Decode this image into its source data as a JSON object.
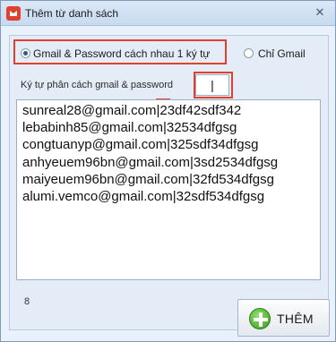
{
  "window": {
    "title": "Thêm từ danh sách",
    "close_glyph": "✕"
  },
  "options": {
    "gmail_password": {
      "label": "Gmail & Password cách nhau 1 ký tự",
      "checked": true
    },
    "gmail_only": {
      "label": "Chỉ Gmail",
      "checked": false
    }
  },
  "separator": {
    "label": "Ký tự phân cách gmail & password",
    "value": "|"
  },
  "accounts": [
    "sunreal28@gmail.com|23df42sdf342",
    "lebabinh85@gmail.com|32534dfgsg",
    "congtuanyp@gmail.com|325sdf34dfgsg",
    "anhyeuem96bn@gmail.com|3sd2534dfgsg",
    "maiyeuem96bn@gmail.com|32fd534dfgsg",
    "alumi.vemco@gmail.com|32sdf534dfgsg"
  ],
  "count": "8",
  "add_button": {
    "label": "THÊM"
  },
  "colors": {
    "highlight": "#e0412f",
    "accent": "#3a9a1e"
  }
}
